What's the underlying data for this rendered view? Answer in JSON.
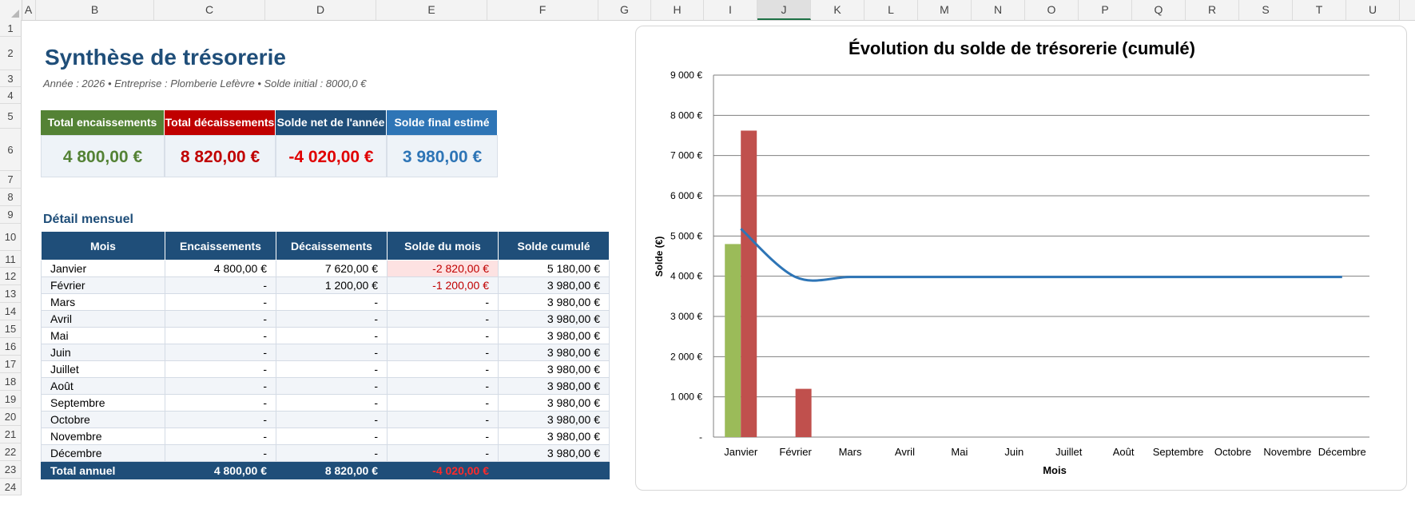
{
  "sheet": {
    "columns": [
      "A",
      "B",
      "C",
      "D",
      "E",
      "F",
      "G",
      "H",
      "I",
      "J",
      "K",
      "L",
      "M",
      "N",
      "O",
      "P",
      "Q",
      "R",
      "S",
      "T",
      "U"
    ],
    "rows": [
      "1",
      "2",
      "3",
      "4",
      "5",
      "6",
      "7",
      "8",
      "9",
      "10",
      "11",
      "12",
      "13",
      "14",
      "15",
      "16",
      "17",
      "18",
      "19",
      "20",
      "21",
      "22",
      "23",
      "24"
    ],
    "selected_column": "J"
  },
  "summary": {
    "title": "Synthèse de trésorerie",
    "subtitle": "Année : 2026  •  Entreprise : Plomberie Lefèvre  •  Solde initial : 8000,0 €"
  },
  "kpis": [
    {
      "label": "Total encaissements",
      "value": "4 800,00 €",
      "header_color": "#548235",
      "value_color": "#548235"
    },
    {
      "label": "Total décaissements",
      "value": "8 820,00 €",
      "header_color": "#c00000",
      "value_color": "#c00000"
    },
    {
      "label": "Solde net de l'année",
      "value": "-4 020,00 €",
      "header_color": "#1f4e79",
      "value_color": "#e00000"
    },
    {
      "label": "Solde final estimé",
      "value": "3 980,00 €",
      "header_color": "#2e75b6",
      "value_color": "#2e75b6"
    }
  ],
  "detail": {
    "section_title": "Détail mensuel",
    "headers": [
      "Mois",
      "Encaissements",
      "Décaissements",
      "Solde du mois",
      "Solde cumulé"
    ],
    "rows": [
      [
        "Janvier",
        "4 800,00 €",
        "7 620,00 €",
        "-2 820,00 €",
        "5 180,00 €"
      ],
      [
        "Février",
        "-",
        "1 200,00 €",
        "-1 200,00 €",
        "3 980,00 €"
      ],
      [
        "Mars",
        "-",
        "-",
        "-",
        "3 980,00 €"
      ],
      [
        "Avril",
        "-",
        "-",
        "-",
        "3 980,00 €"
      ],
      [
        "Mai",
        "-",
        "-",
        "-",
        "3 980,00 €"
      ],
      [
        "Juin",
        "-",
        "-",
        "-",
        "3 980,00 €"
      ],
      [
        "Juillet",
        "-",
        "-",
        "-",
        "3 980,00 €"
      ],
      [
        "Août",
        "-",
        "-",
        "-",
        "3 980,00 €"
      ],
      [
        "Septembre",
        "-",
        "-",
        "-",
        "3 980,00 €"
      ],
      [
        "Octobre",
        "-",
        "-",
        "-",
        "3 980,00 €"
      ],
      [
        "Novembre",
        "-",
        "-",
        "-",
        "3 980,00 €"
      ],
      [
        "Décembre",
        "-",
        "-",
        "-",
        "3 980,00 €"
      ]
    ],
    "total": [
      "Total annuel",
      "4 800,00 €",
      "8 820,00 €",
      "-4 020,00 €",
      ""
    ]
  },
  "chart_data": {
    "type": "bar",
    "title": "Évolution du solde de trésorerie (cumulé)",
    "xlabel": "Mois",
    "ylabel": "Solde (€)",
    "ylim": [
      0,
      9000
    ],
    "yticks": [
      "-",
      "1 000 €",
      "2 000 €",
      "3 000 €",
      "4 000 €",
      "5 000 €",
      "6 000 €",
      "7 000 €",
      "8 000 €",
      "9 000 €"
    ],
    "grid": true,
    "categories": [
      "Janvier",
      "Février",
      "Mars",
      "Avril",
      "Mai",
      "Juin",
      "Juillet",
      "Août",
      "Septembre",
      "Octobre",
      "Novembre",
      "Décembre"
    ],
    "series": [
      {
        "type": "bar",
        "color": "#9bbb59",
        "values": [
          4800,
          0,
          0,
          0,
          0,
          0,
          0,
          0,
          0,
          0,
          0,
          0
        ]
      },
      {
        "type": "bar",
        "color": "#c0504d",
        "values": [
          7620,
          1200,
          0,
          0,
          0,
          0,
          0,
          0,
          0,
          0,
          0,
          0
        ]
      },
      {
        "type": "line",
        "color": "#2e75b6",
        "values": [
          5180,
          3980,
          3980,
          3980,
          3980,
          3980,
          3980,
          3980,
          3980,
          3980,
          3980,
          3980
        ]
      }
    ]
  }
}
